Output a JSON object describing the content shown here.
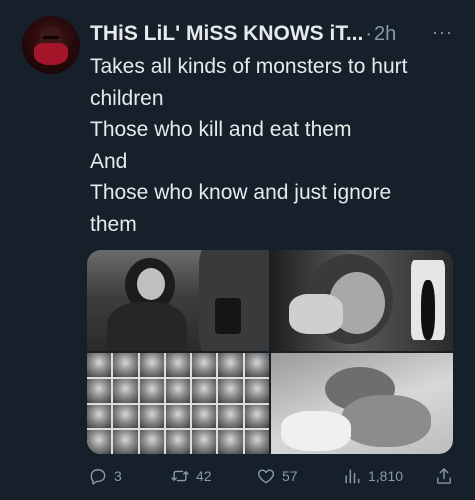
{
  "tweet": {
    "display_name": "THiS LiL' MiSS KNOWS iT...",
    "separator": "·",
    "time": "2h",
    "more_label": "···",
    "text_lines": [
      "Takes all kinds of monsters to hurt",
      "children",
      "Those who kill and eat them",
      "And",
      "Those who know and just ignore",
      "them"
    ]
  },
  "media": {
    "images": [
      "child-with-police-officer-photo",
      "crying-girl-bound-hands-photo",
      "missing-children-faces-collage-photo",
      "child-on-bed-photo"
    ]
  },
  "actions": {
    "replies": "3",
    "reposts": "42",
    "likes": "57",
    "views": "1,810"
  },
  "icons": {
    "reply": "speech-bubble-icon",
    "repost": "retweet-arrows-icon",
    "like": "heart-icon",
    "views": "bar-chart-icon",
    "share": "share-upload-icon"
  },
  "colors": {
    "background": "#15202b",
    "text": "#e7e9ea",
    "muted": "#8b98a5"
  }
}
